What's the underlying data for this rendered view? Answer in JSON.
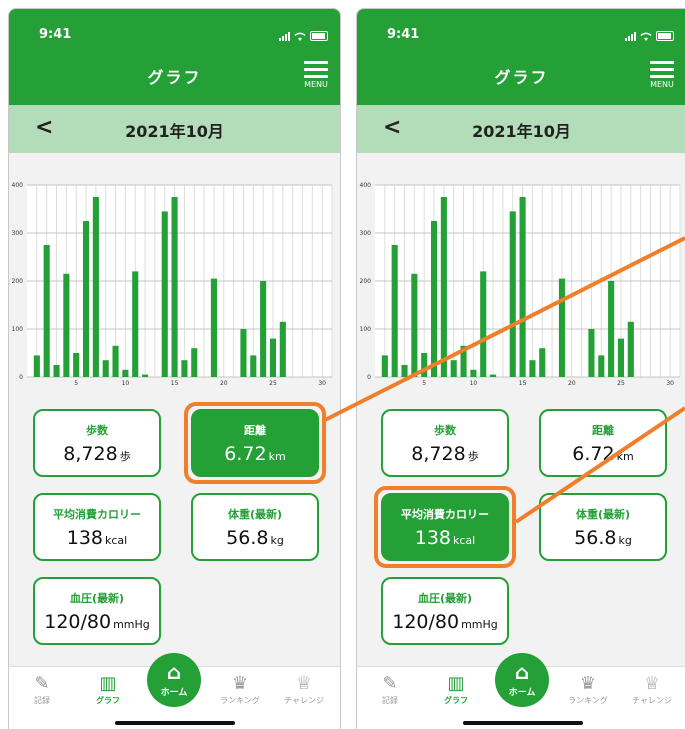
{
  "screens": [
    {
      "time": "9:41",
      "title": "グラフ",
      "menu_label": "MENU",
      "month_label": "2021年10月",
      "cards": [
        {
          "label": "歩数",
          "value": "8,728",
          "unit": "歩"
        },
        {
          "label": "距離",
          "value": "6.72",
          "unit": "km"
        },
        {
          "label": "平均消費カロリー",
          "value": "138",
          "unit": "kcal"
        },
        {
          "label": "体重(最新)",
          "value": "56.8",
          "unit": "kg"
        },
        {
          "label": "血圧(最新)",
          "value": "120/80",
          "unit": "mmHg"
        }
      ],
      "selected_card": "距離"
    },
    {
      "time": "9:41",
      "title": "グラフ",
      "menu_label": "MENU",
      "month_label": "2021年10月",
      "cards": [
        {
          "label": "歩数",
          "value": "8,728",
          "unit": "歩"
        },
        {
          "label": "距離",
          "value": "6.72",
          "unit": "km"
        },
        {
          "label": "平均消費カロリー",
          "value": "138",
          "unit": "kcal"
        },
        {
          "label": "体重(最新)",
          "value": "56.8",
          "unit": "kg"
        },
        {
          "label": "血圧(最新)",
          "value": "120/80",
          "unit": "mmHg"
        }
      ],
      "selected_card": "平均消費カロリー"
    }
  ],
  "tabs": [
    {
      "label": "記録",
      "icon": "pencil-icon"
    },
    {
      "label": "グラフ",
      "icon": "bar-chart-icon"
    },
    {
      "label": "ホーム",
      "icon": "home-icon"
    },
    {
      "label": "ランキング",
      "icon": "crown-icon"
    },
    {
      "label": "チャレンジ",
      "icon": "trophy-icon"
    }
  ],
  "colors": {
    "primary": "#24a036",
    "month_bar": "#b3ddb8",
    "highlight": "#ef7f2a"
  },
  "chart_data": {
    "type": "bar",
    "x": [
      1,
      2,
      3,
      4,
      5,
      6,
      7,
      8,
      9,
      10,
      11,
      12,
      14,
      15,
      16,
      17,
      19,
      22,
      23,
      24,
      25,
      26
    ],
    "values": [
      45,
      275,
      25,
      215,
      50,
      325,
      375,
      35,
      65,
      15,
      220,
      5,
      345,
      375,
      35,
      60,
      205,
      100,
      45,
      200,
      80,
      115
    ],
    "xticks": [
      5,
      10,
      15,
      20,
      25,
      30
    ],
    "yticks": [
      0,
      100,
      200,
      300,
      400
    ],
    "xlim": [
      0,
      31
    ],
    "ylim": [
      0,
      400
    ],
    "grid": true
  }
}
